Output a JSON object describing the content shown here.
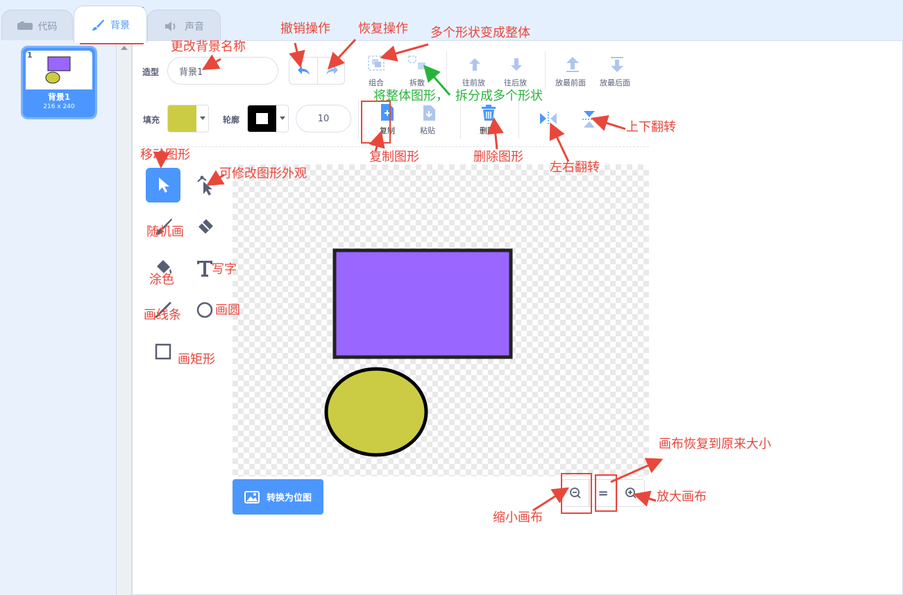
{
  "tabs": [
    {
      "label": "代码",
      "icon": "code-blocks-icon"
    },
    {
      "label": "背景",
      "icon": "paintbrush-icon"
    },
    {
      "label": "声音",
      "icon": "speaker-icon"
    }
  ],
  "costume_list": [
    {
      "index": "1",
      "name": "背景1",
      "size": "216 x 240"
    }
  ],
  "toolbar": {
    "costume_label": "造型",
    "costume_name": "背景1",
    "group_label": "组合",
    "ungroup_label": "拆散",
    "forward_label": "往前放",
    "backward_label": "往后放",
    "front_label": "放最前面",
    "back_label": "放最后面",
    "fill_label": "填充",
    "fill_color": "#cccc44",
    "outline_label": "轮廓",
    "outline_color": "#000000",
    "outline_width": "10",
    "copy_label": "复制",
    "paste_label": "粘贴",
    "delete_label": "删除"
  },
  "convert_button": "转换为位图",
  "zoom": {
    "zoom_out": "zoom-out-icon",
    "reset": "=",
    "zoom_in": "zoom-in-icon"
  },
  "colors": {
    "accent": "#4c97ff",
    "annotation": "#e8473c",
    "rect_fill": "#9966ff",
    "ellipse_fill": "#cccc44"
  },
  "annotations": {
    "undo": "撤销操作",
    "redo": "恢复操作",
    "group": "多个形状变成整体",
    "rename": "更改背景名称",
    "ungroup_green_1": "将整体图形，",
    "ungroup_green_2": "拆分成多个形状",
    "flip_vertical": "上下翻转",
    "copy_shape": "复制图形",
    "delete_shape": "删除图形",
    "flip_horizontal": "左右翻转",
    "move_shape": "移动图形",
    "reshape": "可修改图形外观",
    "brush": "随机画",
    "fill": "涂色",
    "text": "写字",
    "line": "画线条",
    "circle": "画圆",
    "rect": "画矩形",
    "reset_zoom": "画布恢复到原来大小",
    "zoom_in": "放大画布",
    "zoom_out": "缩小画布"
  }
}
